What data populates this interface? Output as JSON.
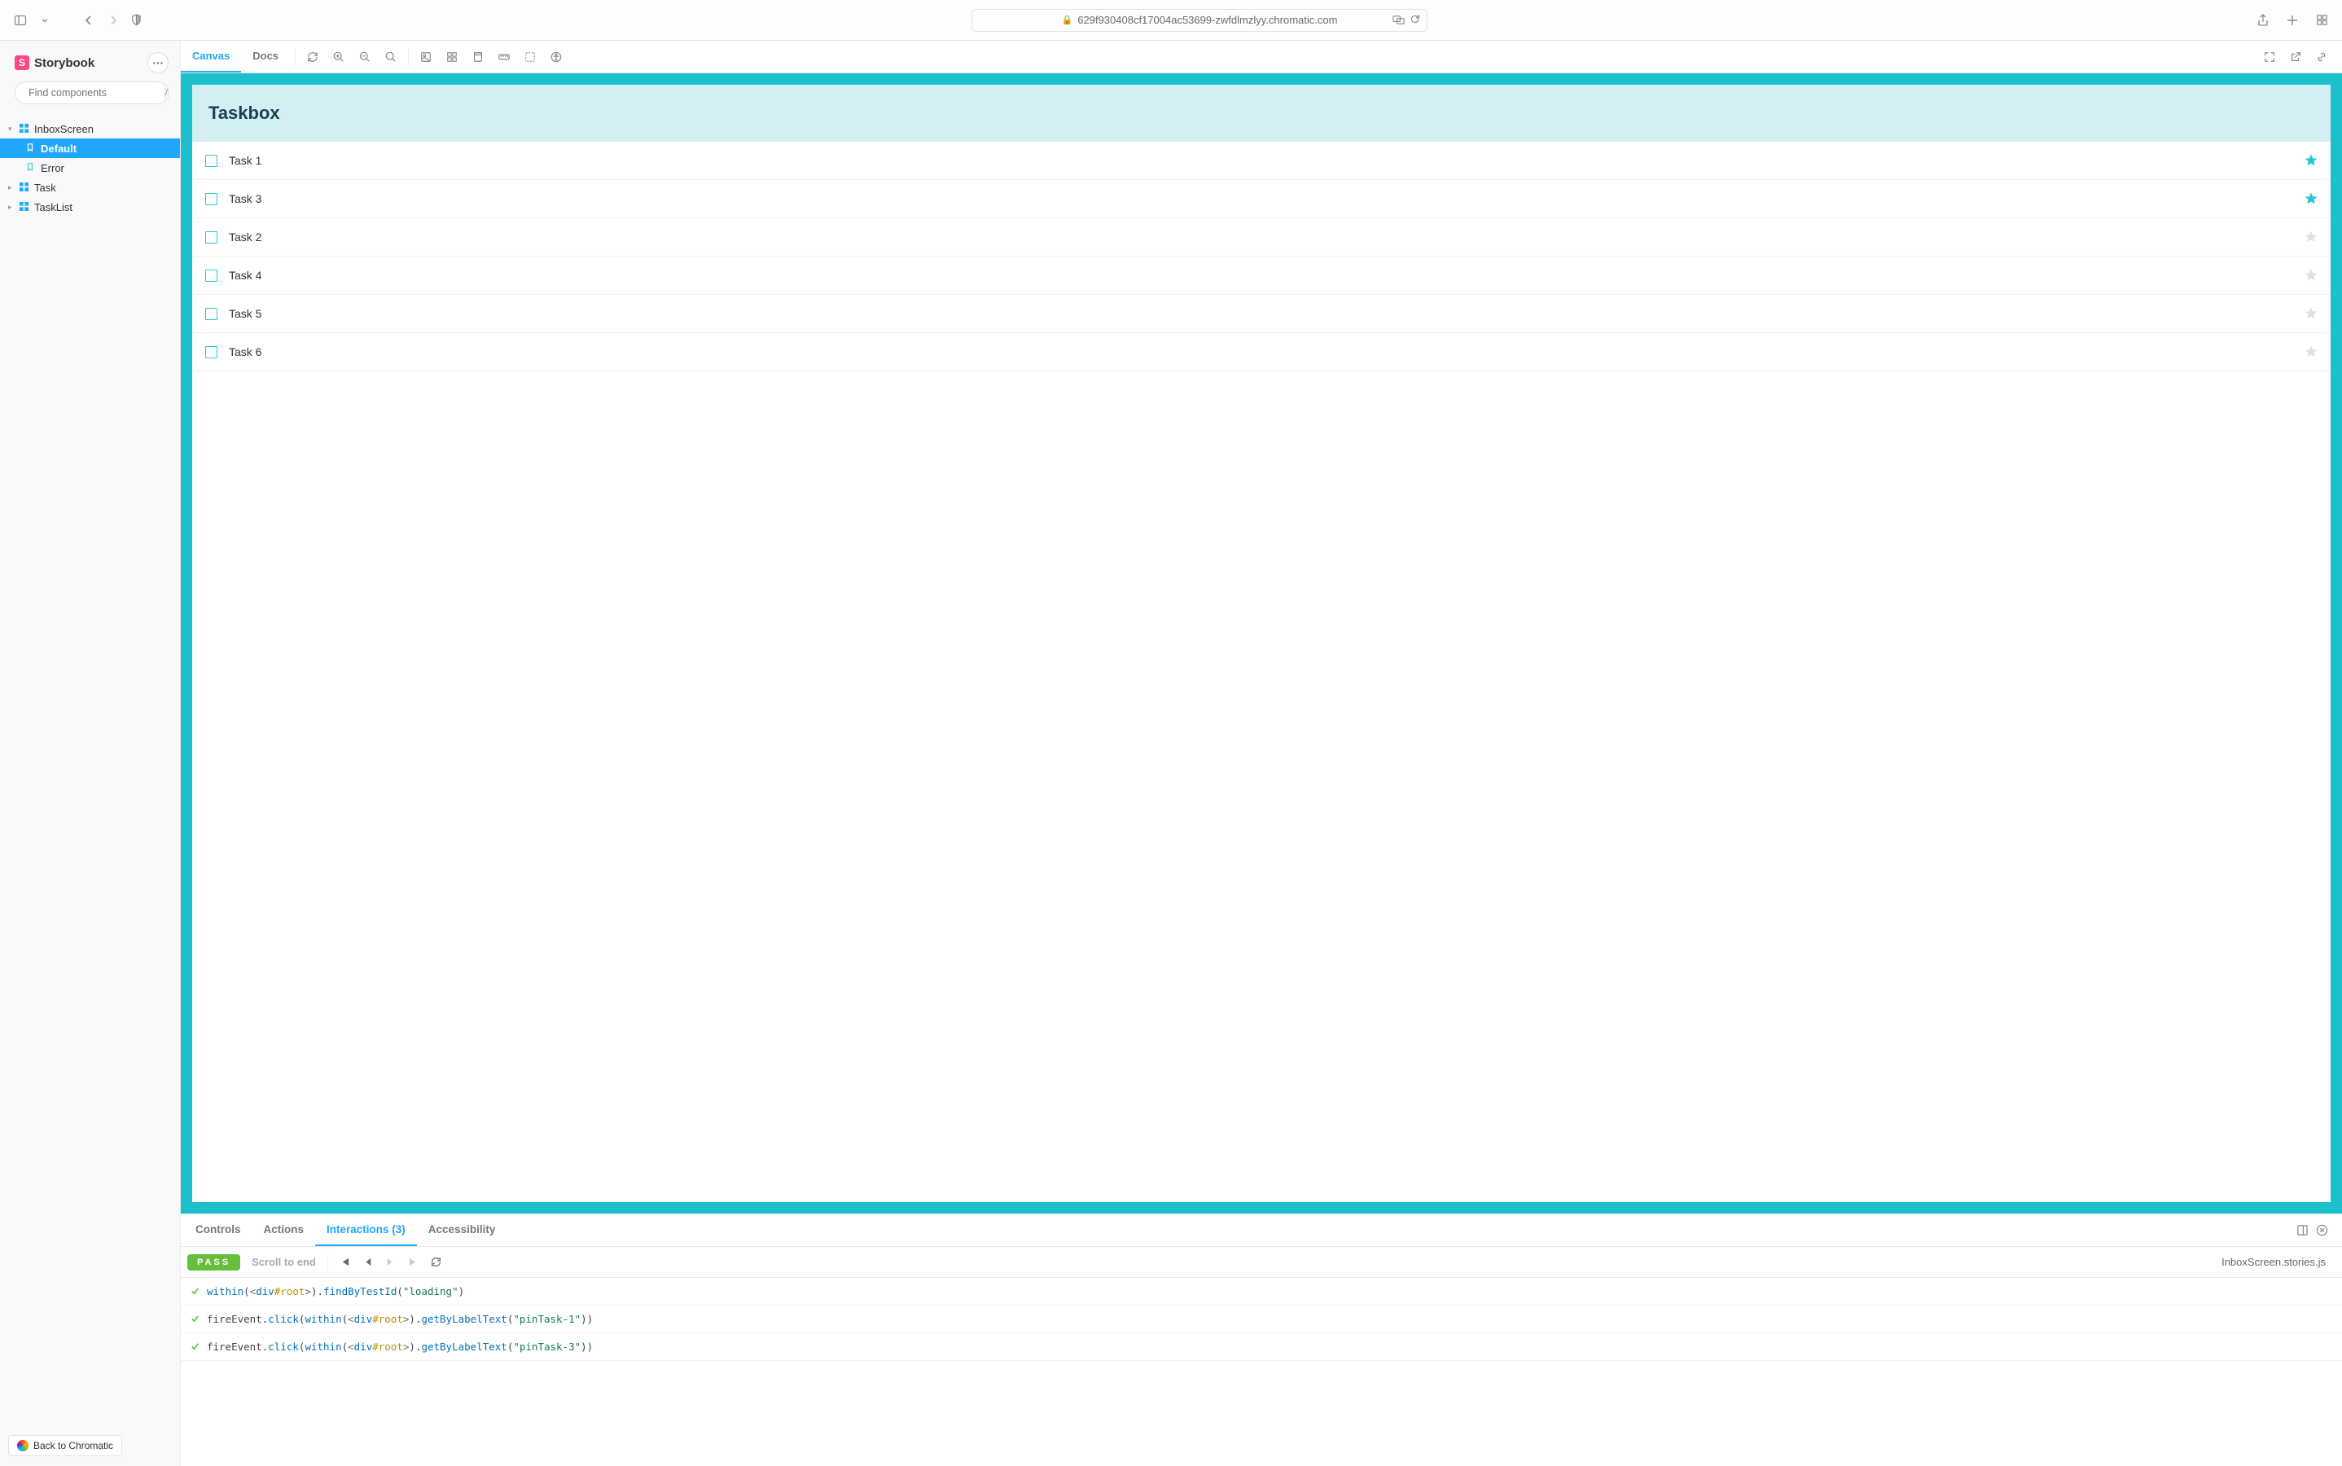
{
  "browser": {
    "url": "629f930408cf17004ac53699-zwfdlmzlyy.chromatic.com"
  },
  "sidebar": {
    "brand": "Storybook",
    "searchPlaceholder": "Find components",
    "searchShortcut": "/",
    "tree": [
      {
        "type": "component",
        "label": "InboxScreen",
        "expanded": true
      },
      {
        "type": "story",
        "label": "Default",
        "active": true
      },
      {
        "type": "story",
        "label": "Error",
        "active": false
      },
      {
        "type": "component",
        "label": "Task",
        "expanded": false
      },
      {
        "type": "component",
        "label": "TaskList",
        "expanded": false
      }
    ],
    "chromaticLabel": "Back to Chromatic"
  },
  "toolbar": {
    "tabs": {
      "canvas": "Canvas",
      "docs": "Docs"
    }
  },
  "canvas": {
    "appTitle": "Taskbox",
    "tasks": [
      {
        "title": "Task 1",
        "pinned": true
      },
      {
        "title": "Task 3",
        "pinned": true
      },
      {
        "title": "Task 2",
        "pinned": false
      },
      {
        "title": "Task 4",
        "pinned": false
      },
      {
        "title": "Task 5",
        "pinned": false
      },
      {
        "title": "Task 6",
        "pinned": false
      }
    ]
  },
  "addons": {
    "tabs": {
      "controls": "Controls",
      "actions": "Actions",
      "interactions": "Interactions (3)",
      "a11y": "Accessibility"
    },
    "interactions": {
      "status": "PASS",
      "scrollLabel": "Scroll to end",
      "file": "InboxScreen.stories.js",
      "rows": [
        {
          "call": "within",
          "arg": "<div#root>",
          "chain": "findByTestId",
          "param": "\"loading\""
        },
        {
          "prefix": "fireEvent.click",
          "call": "within",
          "arg": "<div#root>",
          "chain": "getByLabelText",
          "param": "\"pinTask-1\""
        },
        {
          "prefix": "fireEvent.click",
          "call": "within",
          "arg": "<div#root>",
          "chain": "getByLabelText",
          "param": "\"pinTask-3\""
        }
      ]
    }
  }
}
